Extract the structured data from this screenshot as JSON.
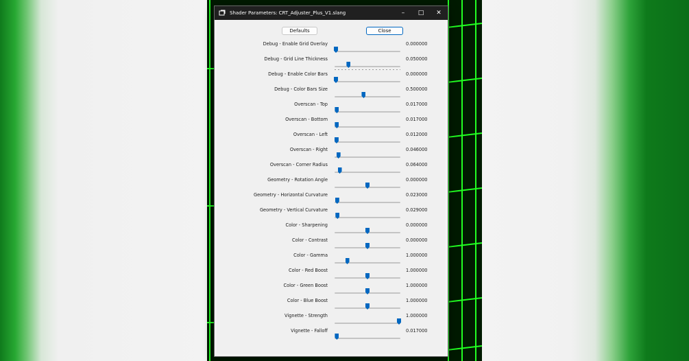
{
  "window": {
    "title": "Shader Parameters: CRT_Adjuster_Plus_V1.slang",
    "minimize_glyph": "–",
    "maximize_glyph": "□",
    "close_glyph": "✕"
  },
  "buttons": {
    "defaults_label": "Defaults",
    "close_label": "Close"
  },
  "colors": {
    "accent": "#0067c0",
    "titlebar": "#202020",
    "dialog_bg": "#f0f0f0",
    "game_grid": "#22ff22"
  },
  "parameters": [
    {
      "label": "Debug - Enable Grid Overlay",
      "value": "0.000000",
      "position": 0.0
    },
    {
      "label": "Debug - Grid Line Thickness",
      "value": "0.050000",
      "position": 0.2,
      "ticks": true
    },
    {
      "label": "Debug - Enable Color Bars",
      "value": "0.000000",
      "position": 0.0
    },
    {
      "label": "Debug - Color Bars Size",
      "value": "0.500000",
      "position": 0.44
    },
    {
      "label": "Overscan - Top",
      "value": "0.017000",
      "position": 0.015
    },
    {
      "label": "Overscan - Bottom",
      "value": "0.017000",
      "position": 0.015
    },
    {
      "label": "Overscan - Left",
      "value": "0.012000",
      "position": 0.01
    },
    {
      "label": "Overscan - Right",
      "value": "0.046000",
      "position": 0.04
    },
    {
      "label": "Overscan - Corner Radius",
      "value": "0.064000",
      "position": 0.06
    },
    {
      "label": "Geometry - Rotation Angle",
      "value": "0.000000",
      "position": 0.5
    },
    {
      "label": "Geometry - Horizontal Curvature",
      "value": "0.023000",
      "position": 0.02
    },
    {
      "label": "Geometry - Vertical Curvature",
      "value": "0.029000",
      "position": 0.025
    },
    {
      "label": "Color - Sharpening",
      "value": "0.000000",
      "position": 0.5
    },
    {
      "label": "Color - Contrast",
      "value": "0.000000",
      "position": 0.5
    },
    {
      "label": "Color - Gamma",
      "value": "1.000000",
      "position": 0.18
    },
    {
      "label": "Color - Red Boost",
      "value": "1.000000",
      "position": 0.5
    },
    {
      "label": "Color - Green Boost",
      "value": "1.000000",
      "position": 0.5
    },
    {
      "label": "Color - Blue Boost",
      "value": "1.000000",
      "position": 0.5
    },
    {
      "label": "Vignette - Strength",
      "value": "1.000000",
      "position": 1.0
    },
    {
      "label": "Vignette - Falloff",
      "value": "0.017000",
      "position": 0.015
    }
  ]
}
